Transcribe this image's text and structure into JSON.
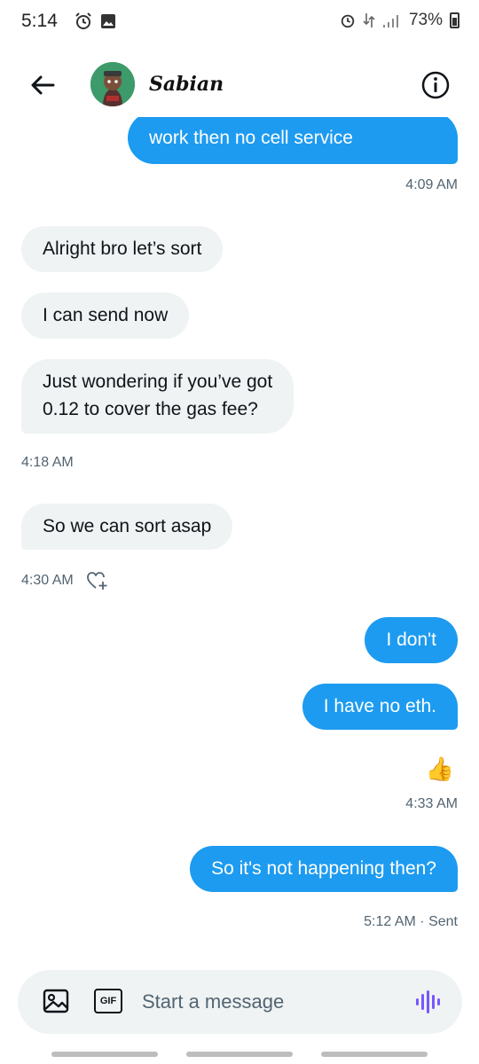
{
  "status_bar": {
    "time": "5:14",
    "battery": "73%"
  },
  "header": {
    "contact_name": "Sabian",
    "avatar_bg": "#3d9a6a"
  },
  "messages": [
    {
      "direction": "out",
      "text": "work then no cell service"
    },
    {
      "timestamp": "4:09 AM"
    },
    {
      "direction": "in",
      "text": "Alright bro let’s sort"
    },
    {
      "direction": "in",
      "text": "I can send now"
    },
    {
      "direction": "in",
      "text_lines": [
        "Just wondering if you’ve got",
        "0.12 to cover the gas fee?"
      ]
    },
    {
      "timestamp": "4:18 AM"
    },
    {
      "direction": "in",
      "text": "So we can sort asap"
    },
    {
      "timestamp": "4:30 AM"
    },
    {
      "direction": "out",
      "text": "I don't"
    },
    {
      "direction": "out",
      "text": "I have no eth."
    },
    {
      "reaction": "👍"
    },
    {
      "timestamp": "4:33 AM"
    },
    {
      "direction": "out",
      "text": "So it's not happening then?"
    },
    {
      "timestamp": "5:12 AM · Sent"
    }
  ],
  "composer": {
    "placeholder": "Start a message",
    "gif_label": "GIF"
  },
  "colors": {
    "outgoing_bubble": "#1d9bf0",
    "incoming_bubble": "#eff3f4",
    "voice_icon": "#7856ff"
  }
}
